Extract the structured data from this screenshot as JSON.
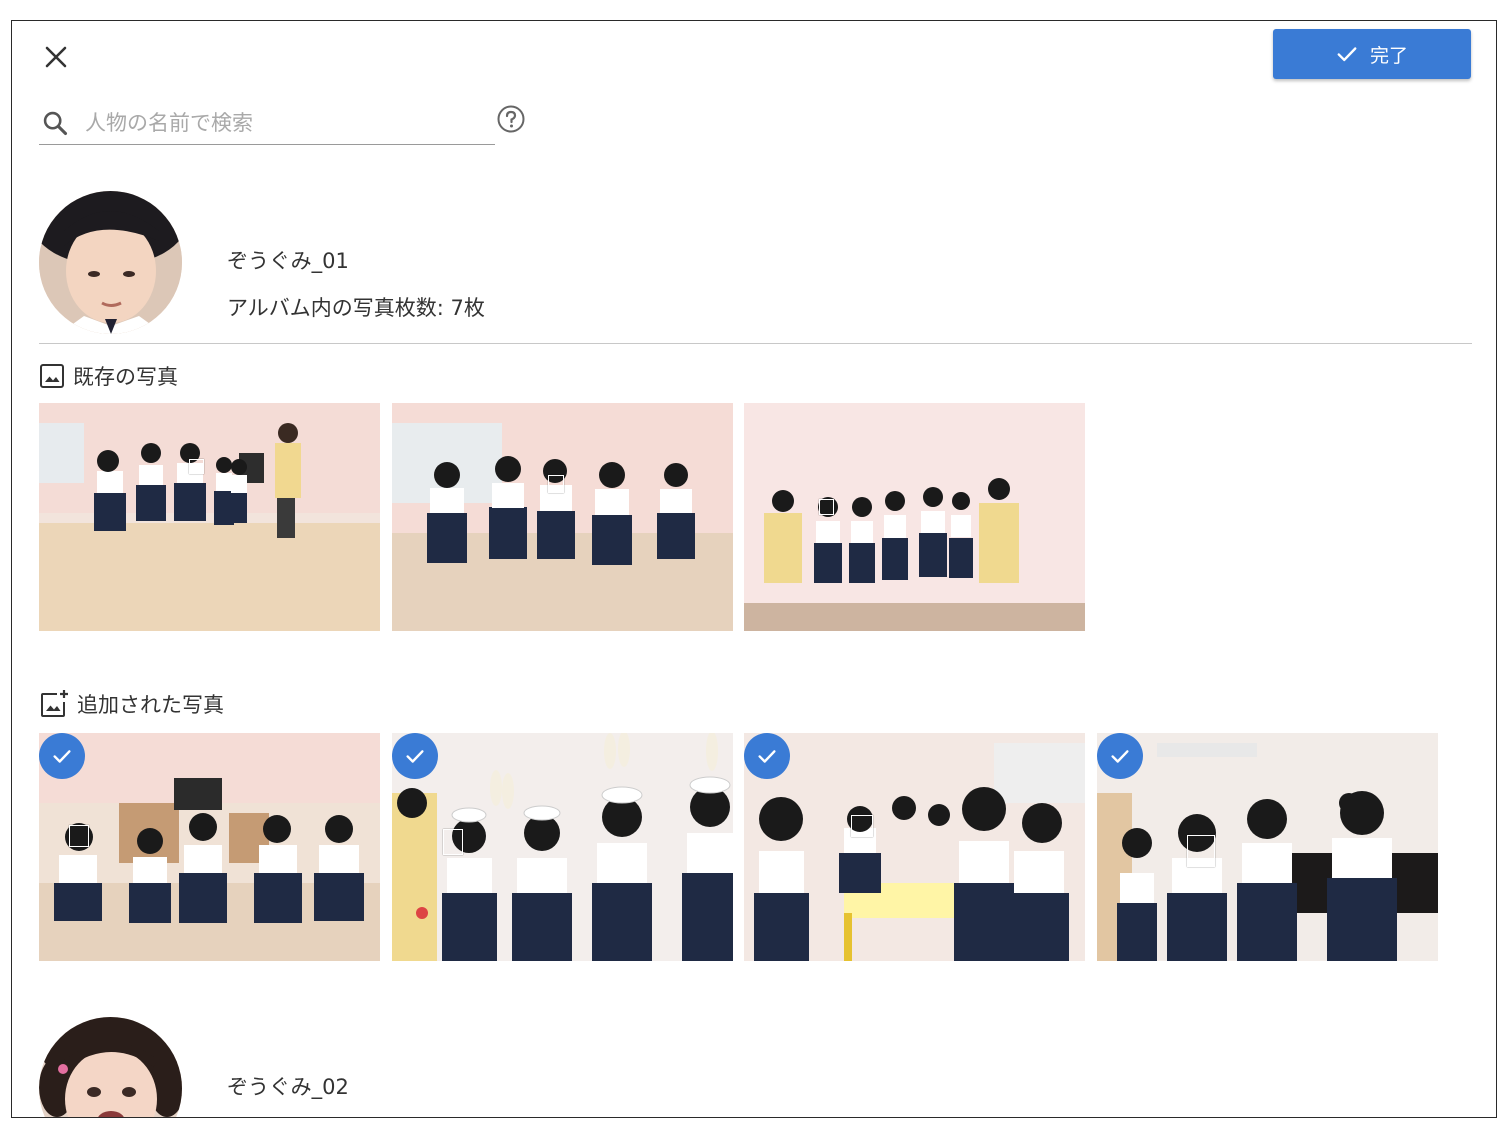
{
  "toolbar": {
    "done_label": "完了"
  },
  "search": {
    "placeholder": "人物の名前で検索"
  },
  "people": [
    {
      "name": "ぞうぐみ_01",
      "photo_count_label": "アルバム内の写真枚数: 7枚",
      "sections": [
        {
          "title": "既存の写真",
          "icon": "image-icon",
          "photos": 3,
          "selected": false
        },
        {
          "title": "追加された写真",
          "icon": "add-photo-icon",
          "photos": 4,
          "selected": true
        }
      ]
    },
    {
      "name": "ぞうぐみ_02"
    }
  ],
  "colors": {
    "accent": "#3a7bd5",
    "border": "#2a2a2a",
    "divider": "#c8c8c8"
  }
}
